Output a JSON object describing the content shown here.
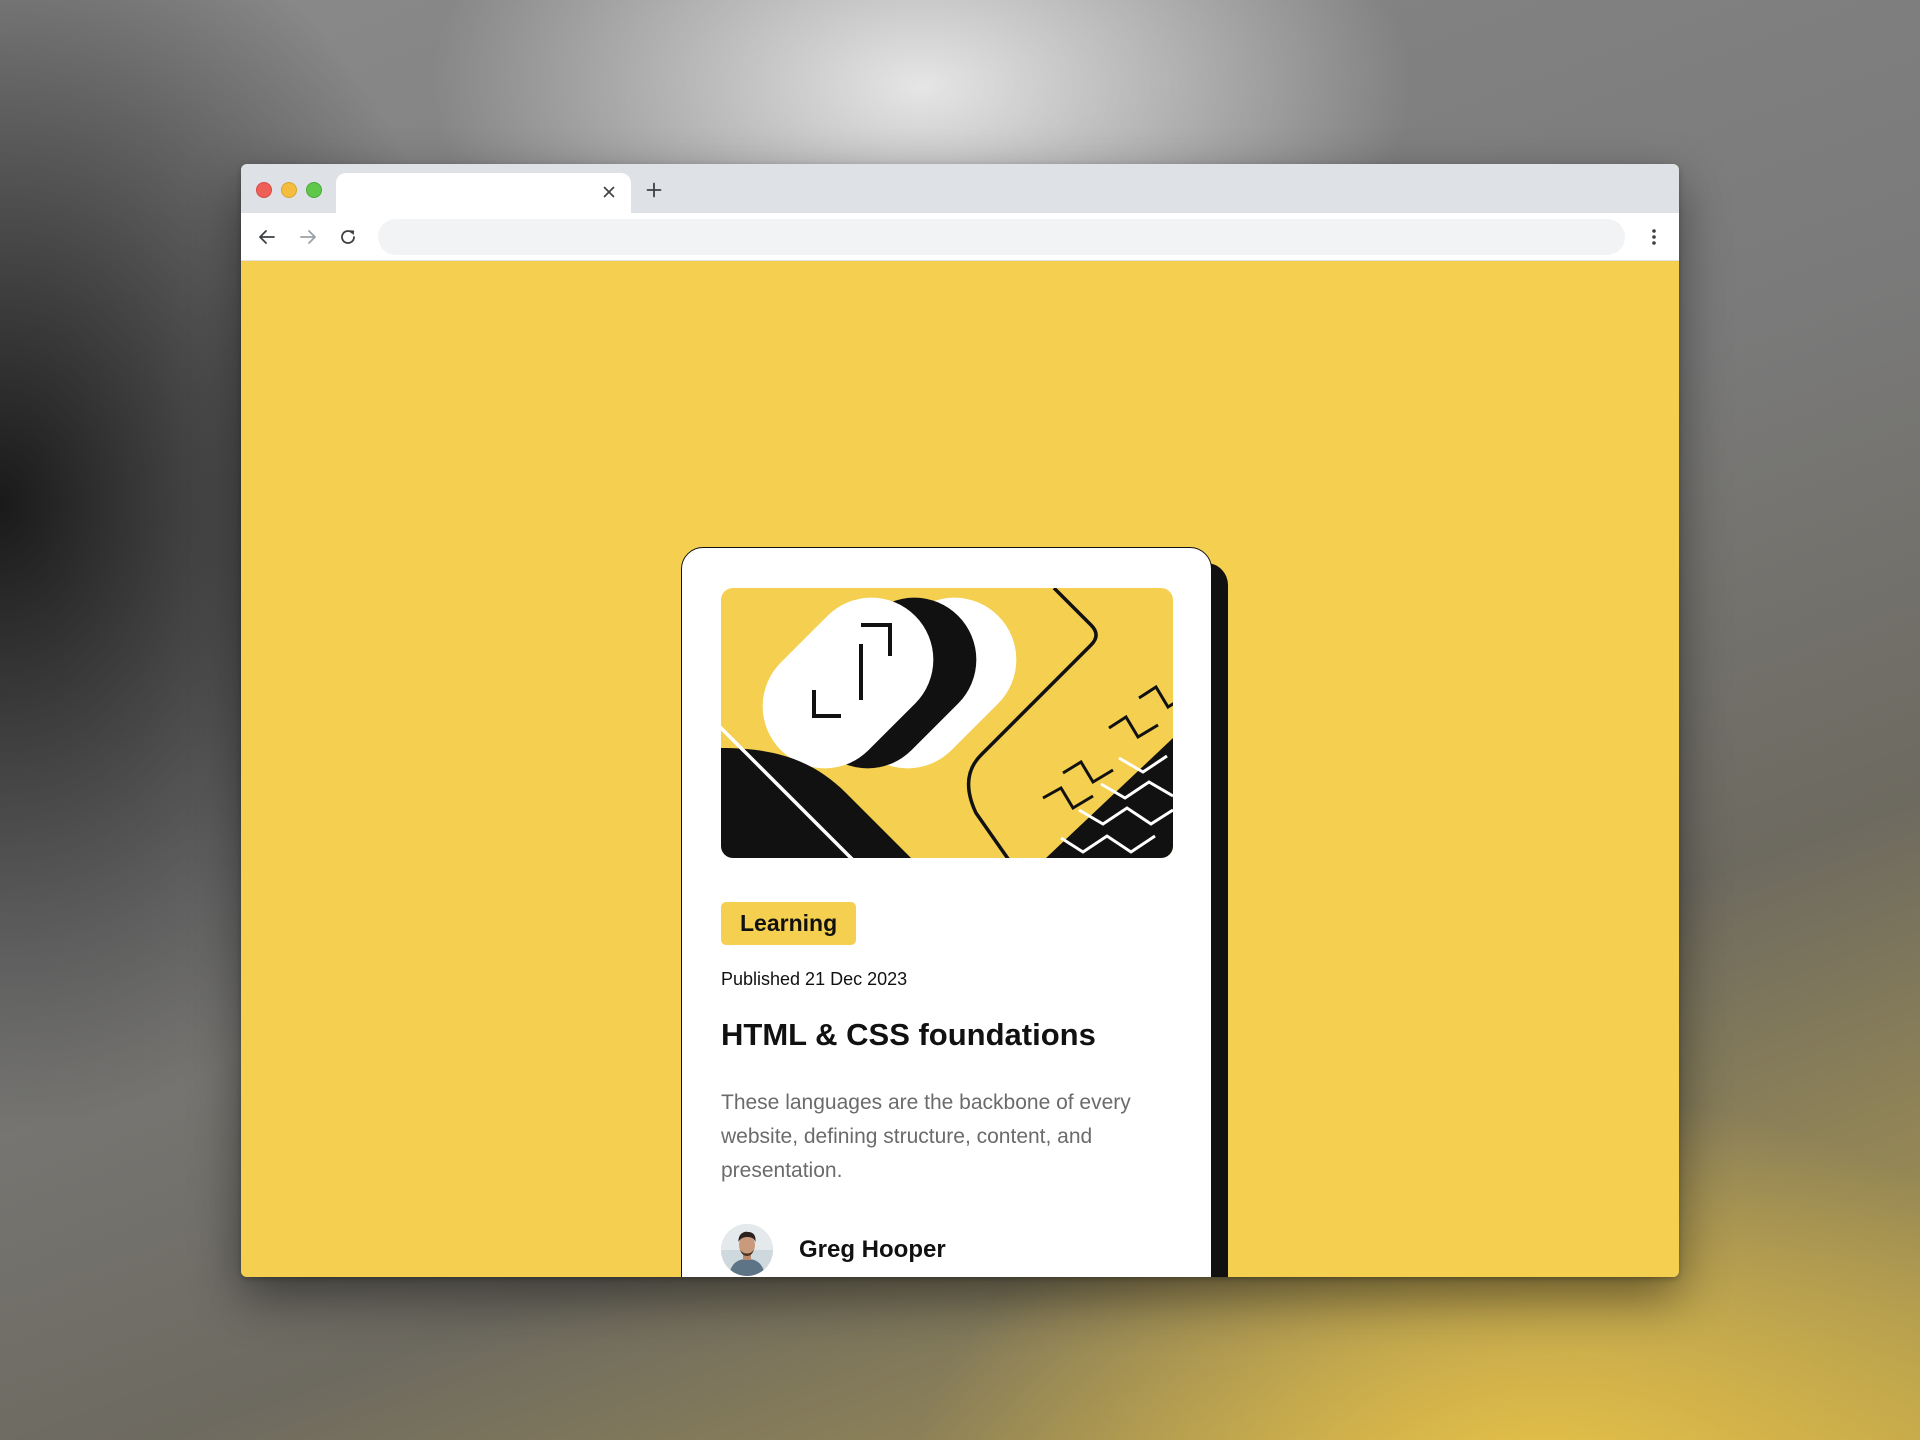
{
  "browser": {
    "tab_title": "",
    "address": "",
    "colors": {
      "tabbar": "#dee1e6",
      "toolbar": "#ffffff",
      "omnibox": "#f1f3f4",
      "traffic_red": "#ee5f57",
      "traffic_yellow": "#f4bd3f",
      "traffic_green": "#5fc84a"
    },
    "icons": {
      "close": "close-icon",
      "new_tab": "plus-icon",
      "back": "arrow-left-icon",
      "forward": "arrow-right-icon",
      "reload": "reload-icon",
      "menu": "kebab-menu-icon"
    }
  },
  "page": {
    "background": "#f4cf50"
  },
  "card": {
    "hero_image": "abstract-illustration",
    "category": "Learning",
    "published": "Published 21 Dec 2023",
    "title": "HTML & CSS foundations",
    "description": "These languages are the backbone of every website, defining structure, content, and presentation.",
    "author": {
      "name": "Greg Hooper",
      "avatar": "author-photo"
    },
    "colors": {
      "accent": "#f4cf50",
      "text": "#111111",
      "muted": "#6b6b6b",
      "surface": "#ffffff"
    }
  }
}
